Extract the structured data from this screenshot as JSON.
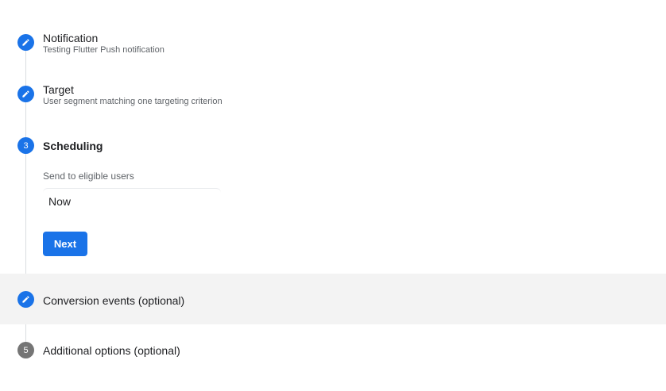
{
  "steps": [
    {
      "title": "Notification",
      "subtitle": "Testing Flutter Push notification",
      "icon": "pencil-icon"
    },
    {
      "title": "Target",
      "subtitle": "User segment matching one targeting criterion",
      "icon": "pencil-icon"
    },
    {
      "title": "Scheduling",
      "number": "3"
    },
    {
      "title": "Conversion events (optional)",
      "icon": "pencil-icon"
    },
    {
      "title": "Additional options (optional)",
      "number": "5"
    }
  ],
  "scheduling": {
    "field_label": "Send to eligible users",
    "selected_value": "Now",
    "next_label": "Next"
  },
  "colors": {
    "accent": "#1a73e8",
    "inactive": "#757575",
    "highlight_row": "#f3f3f3"
  }
}
